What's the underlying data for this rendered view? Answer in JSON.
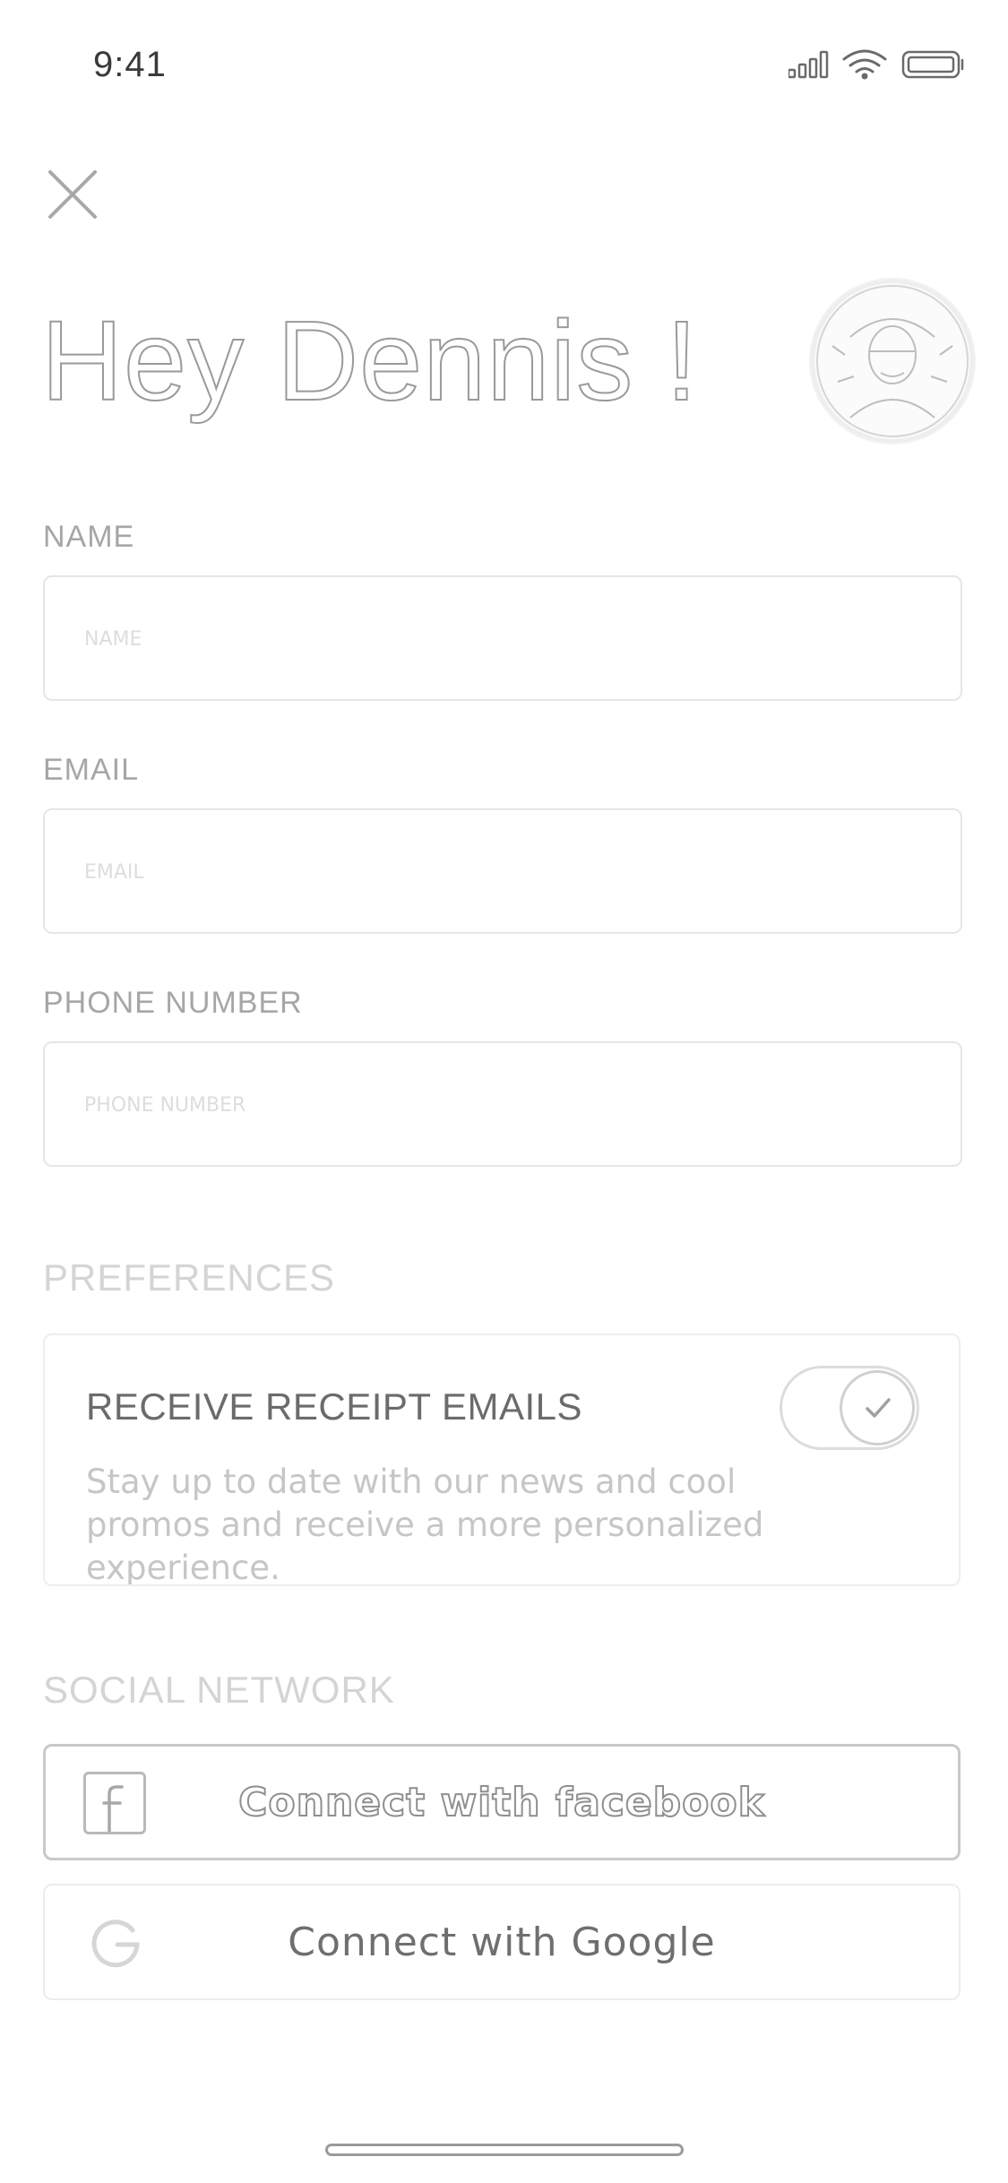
{
  "status_bar": {
    "time": "9:41"
  },
  "header": {
    "greeting": "Hey Dennis !"
  },
  "form": {
    "name": {
      "label": "NAME",
      "placeholder": "NAME",
      "value": ""
    },
    "email": {
      "label": "EMAIL",
      "placeholder": "EMAIL",
      "value": ""
    },
    "phone": {
      "label": "PHONE NUMBER",
      "placeholder": "PHONE NUMBER",
      "value": ""
    }
  },
  "preferences": {
    "title": "PREFERENCES",
    "receipt_emails": {
      "label": "RECEIVE RECEIPT EMAILS",
      "description": "Stay up to date with our news and cool promos and receive a more personalized experience.",
      "enabled": true
    }
  },
  "social": {
    "title": "SOCIAL NETWORK",
    "facebook_label": "Connect with facebook",
    "google_label": "Connect with Google"
  },
  "icons": {
    "close": "close-icon",
    "avatar": "avatar",
    "toggle": "check-icon",
    "facebook": "facebook-icon",
    "google": "google-icon"
  }
}
